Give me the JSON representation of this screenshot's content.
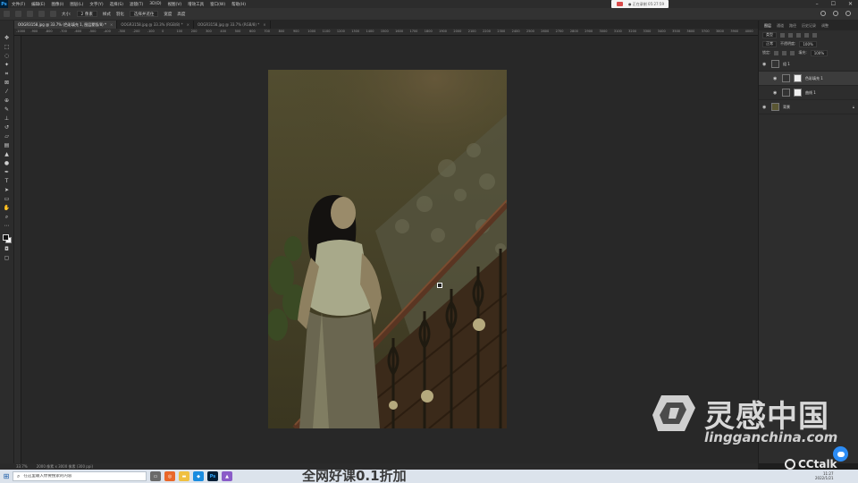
{
  "app": {
    "logo_text": "Ps",
    "menu": [
      "文件(F)",
      "编辑(E)",
      "图像(I)",
      "图层(L)",
      "文字(Y)",
      "选择(S)",
      "滤镜(T)",
      "3D(D)",
      "视图(V)",
      "增效工具",
      "窗口(W)",
      "帮助(H)"
    ],
    "recording_pill": "● 正在录制 05:27:59"
  },
  "options_bar": {
    "size_label": "大小:",
    "size_value": "2 像素",
    "mode": "样式",
    "feather": "羽化",
    "refine": "选择并遮住",
    "width_label": "宽度",
    "height_label": "高度"
  },
  "tabs": [
    {
      "label": "OOGR3158.jpg @ 33.7% (色彩填充 1, 图层蒙版/8) *",
      "active": true
    },
    {
      "label": "OOGR3158.jpg @ 33.3% (RGB/8) *",
      "active": false
    },
    {
      "label": "OOGR3158.jpg @ 33.7% (RGB/8) *",
      "active": false
    }
  ],
  "ruler_h_ticks": [
    "-1000",
    "-900",
    "-800",
    "-700",
    "-600",
    "-500",
    "-400",
    "-300",
    "-200",
    "-100",
    "0",
    "100",
    "200",
    "300",
    "400",
    "500",
    "600",
    "700",
    "800",
    "900",
    "1000",
    "1100",
    "1200",
    "1300",
    "1400",
    "1500",
    "1600",
    "1700",
    "1800",
    "1900",
    "2000",
    "2100",
    "2200",
    "2300",
    "2400",
    "2500",
    "2600",
    "2700",
    "2800",
    "2900",
    "3000",
    "3100",
    "3200",
    "3300",
    "3400",
    "3500",
    "3600",
    "3700",
    "3800",
    "3900",
    "4000"
  ],
  "panels": {
    "tabs": [
      "图层",
      "通道",
      "路径",
      "历史记录",
      "调整"
    ],
    "active_tab": "图层",
    "filter_label": "类型",
    "blend_mode": "正常",
    "opacity_label": "不透明度:",
    "opacity_value": "100%",
    "lock_label": "锁定:",
    "fill_label": "填充:",
    "fill_value": "100%",
    "layers": [
      {
        "name": "组 1",
        "kind": "group",
        "selected": false,
        "indent": false
      },
      {
        "name": "色彩填充 1",
        "kind": "fill",
        "selected": true,
        "indent": true
      },
      {
        "name": "曲线 1",
        "kind": "curve",
        "selected": false,
        "indent": true
      },
      {
        "name": "背景",
        "kind": "photo",
        "selected": false,
        "indent": false
      }
    ]
  },
  "status": {
    "zoom": "33.7%",
    "doc_info": "2000 像素 x 3000 像素 (300 ppi)"
  },
  "watermark": {
    "title": "灵感中国",
    "url": "lingganchina.com"
  },
  "taskbar": {
    "search_placeholder": "在这里输入你要搜索的内容",
    "promo_text": "全网好课0.1折加",
    "cctalk_label": "CCtalk",
    "time": "11:27",
    "date": "2022/1/21"
  },
  "colors": {
    "photo_wall": "#4e4a2e",
    "accent_blue": "#31a8ff"
  }
}
